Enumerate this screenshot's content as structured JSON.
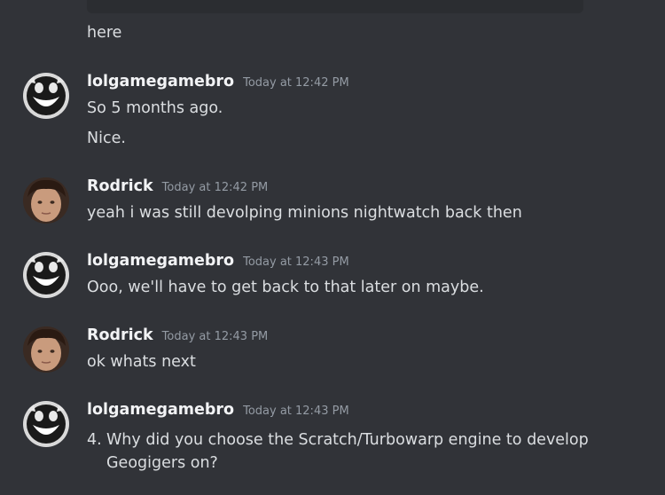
{
  "previous": {
    "tail_text": "here"
  },
  "messages": [
    {
      "username": "lolgamegamebro",
      "timestamp": "Today at 12:42 PM",
      "lines": [
        "So 5 months ago.",
        "Nice."
      ]
    },
    {
      "username": "Rodrick",
      "timestamp": "Today at 12:42 PM",
      "lines": [
        "yeah i was still devolping minions nightwatch back then"
      ]
    },
    {
      "username": "lolgamegamebro",
      "timestamp": "Today at 12:43 PM",
      "lines": [
        "Ooo, we'll have to get back to that later on maybe."
      ]
    },
    {
      "username": "Rodrick",
      "timestamp": "Today at 12:43 PM",
      "lines": [
        "ok whats next"
      ]
    },
    {
      "username": "lolgamegamebro",
      "timestamp": "Today at 12:43 PM",
      "list_items": [
        {
          "number": "4.",
          "text": "Why did you choose the Scratch/Turbowarp engine to develop Geogigers on?"
        }
      ]
    }
  ],
  "colors": {
    "background": "#313338",
    "embed": "#2b2d31",
    "username": "#f2f3f5",
    "timestamp": "#949ba4",
    "text": "#dbdee1"
  },
  "icons": {
    "lolgamegamebro_avatar": "smiling-face-avatar-icon",
    "rodrick_avatar": "photo-face-avatar-icon"
  }
}
